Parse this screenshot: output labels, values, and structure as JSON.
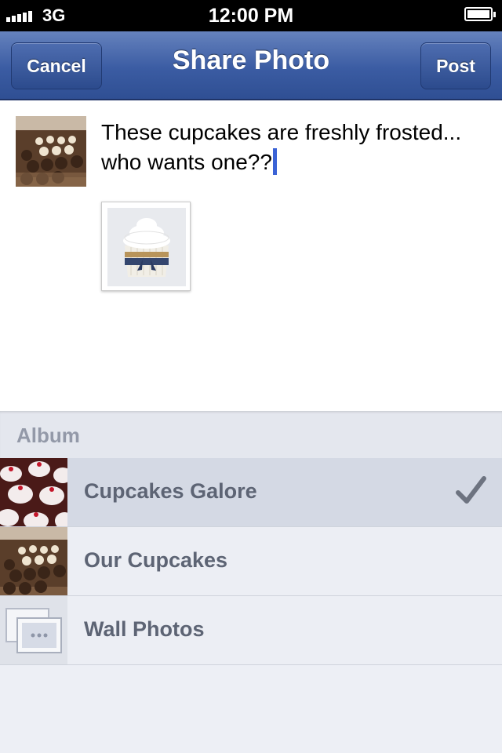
{
  "status_bar": {
    "network": "3G",
    "time": "12:00 PM"
  },
  "nav": {
    "cancel": "Cancel",
    "title": "Share Photo",
    "post": "Post"
  },
  "compose": {
    "message_line1": "These cupcakes are freshly frosted...",
    "message_line2": "who wants one??",
    "profile_thumb_icon": "cupcake-tray-photo",
    "attached_photo_icon": "frosted-cupcake-photo"
  },
  "album": {
    "header": "Album",
    "items": [
      {
        "label": "Cupcakes Galore",
        "selected": true,
        "thumb": "red-velvet-cupcakes-photo"
      },
      {
        "label": "Our Cupcakes",
        "selected": false,
        "thumb": "cupcake-tray-photo"
      },
      {
        "label": "Wall Photos",
        "selected": false,
        "thumb": "wall-photos-icon"
      }
    ]
  },
  "colors": {
    "nav_blue": "#3b5ca3",
    "caret": "#3b63d6",
    "selected_row": "#d4d9e4",
    "label_gray": "#5d6474"
  }
}
